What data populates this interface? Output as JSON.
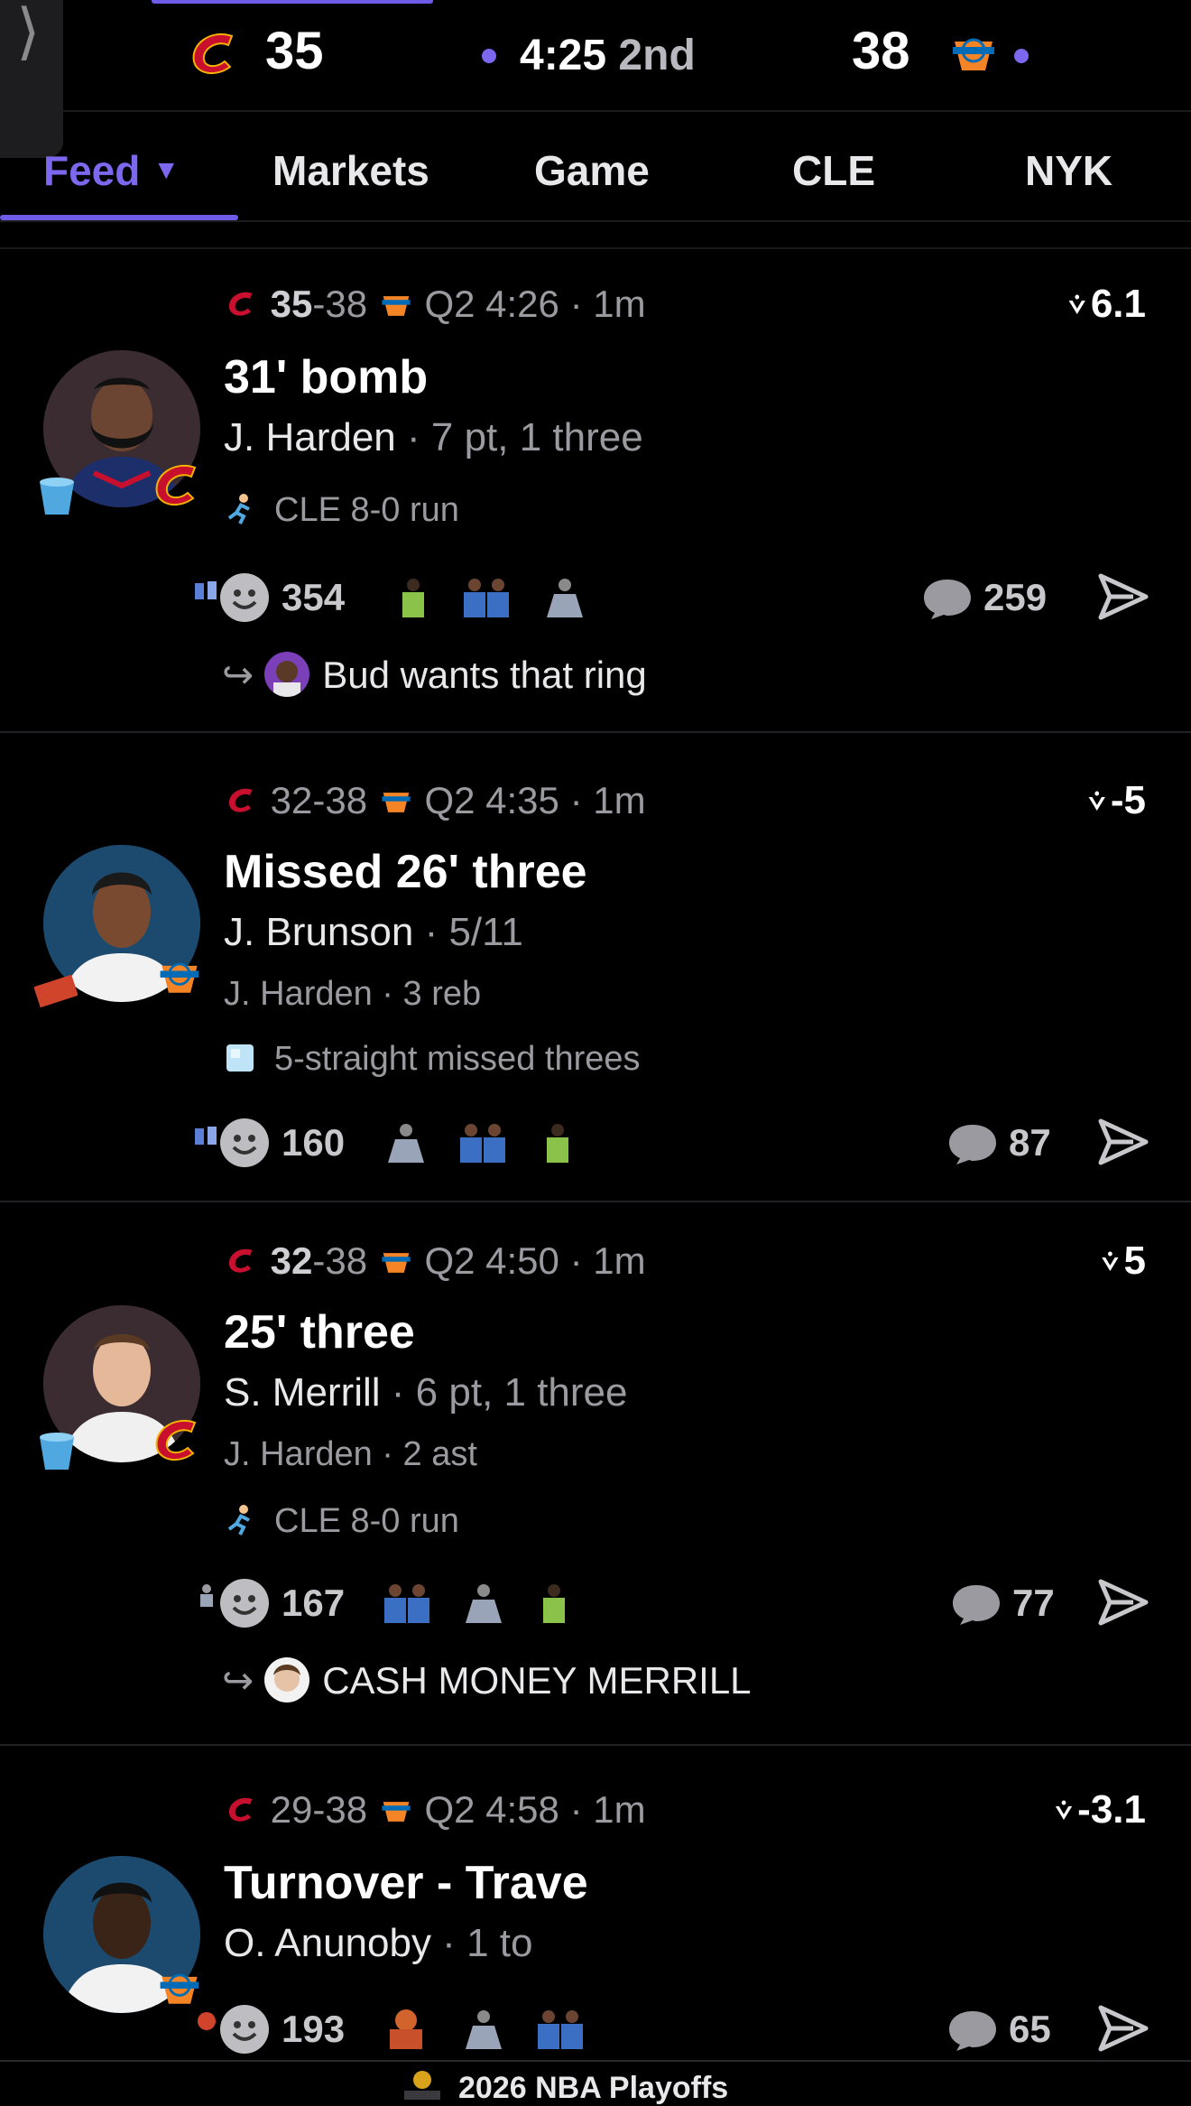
{
  "scoreboard": {
    "home_score": "35",
    "clock": "4:25",
    "period": "2nd",
    "away_score": "38",
    "home_logo_icon": "cavaliers-logo-icon",
    "away_logo_icon": "knicks-logo-icon",
    "accent": "#6c5ce7"
  },
  "tabs": [
    {
      "label": "Feed",
      "active": true
    },
    {
      "label": "Markets"
    },
    {
      "label": "Game"
    },
    {
      "label": "CLE"
    },
    {
      "label": "NYK"
    }
  ],
  "feed": [
    {
      "home_score": "35",
      "away_score": "38",
      "time": "Q2 4:26 · 1m",
      "value": "6.1",
      "title": "31' bomb",
      "player": "J. Harden",
      "player_stat": "7 pt, 1 three",
      "streak_icon": "running-man-icon",
      "streak": "CLE 8-0 run",
      "reaction_count": "354",
      "comment_count": "259",
      "reply": "Bud wants that ring"
    },
    {
      "home_score": "32",
      "away_score": "38",
      "time": "Q2 4:35 · 1m",
      "value": "-5",
      "title": "Missed 26' three",
      "player": "J. Brunson",
      "player_stat": "5/11",
      "secondary_player": "J. Harden",
      "secondary_stat": "3 reb",
      "streak_icon": "ice-cube-icon",
      "streak": "5-straight missed threes",
      "reaction_count": "160",
      "comment_count": "87"
    },
    {
      "home_score": "32",
      "away_score": "38",
      "time": "Q2 4:50 · 1m",
      "value": "5",
      "title": "25' three",
      "player": "S. Merrill",
      "player_stat": "6 pt, 1 three",
      "secondary_player": "J. Harden",
      "secondary_stat": "2 ast",
      "streak_icon": "running-man-icon",
      "streak": "CLE 8-0 run",
      "reaction_count": "167",
      "comment_count": "77",
      "reply": "CASH MONEY MERRILL"
    },
    {
      "home_score": "29",
      "away_score": "38",
      "time": "Q2 4:58 · 1m",
      "value": "-3.1",
      "title": "Turnover - Trave",
      "player": "O. Anunoby",
      "player_stat": "1 to",
      "reaction_count": "193",
      "comment_count": "65"
    }
  ],
  "bottom_bar": {
    "label": "2026 NBA Playoffs"
  }
}
